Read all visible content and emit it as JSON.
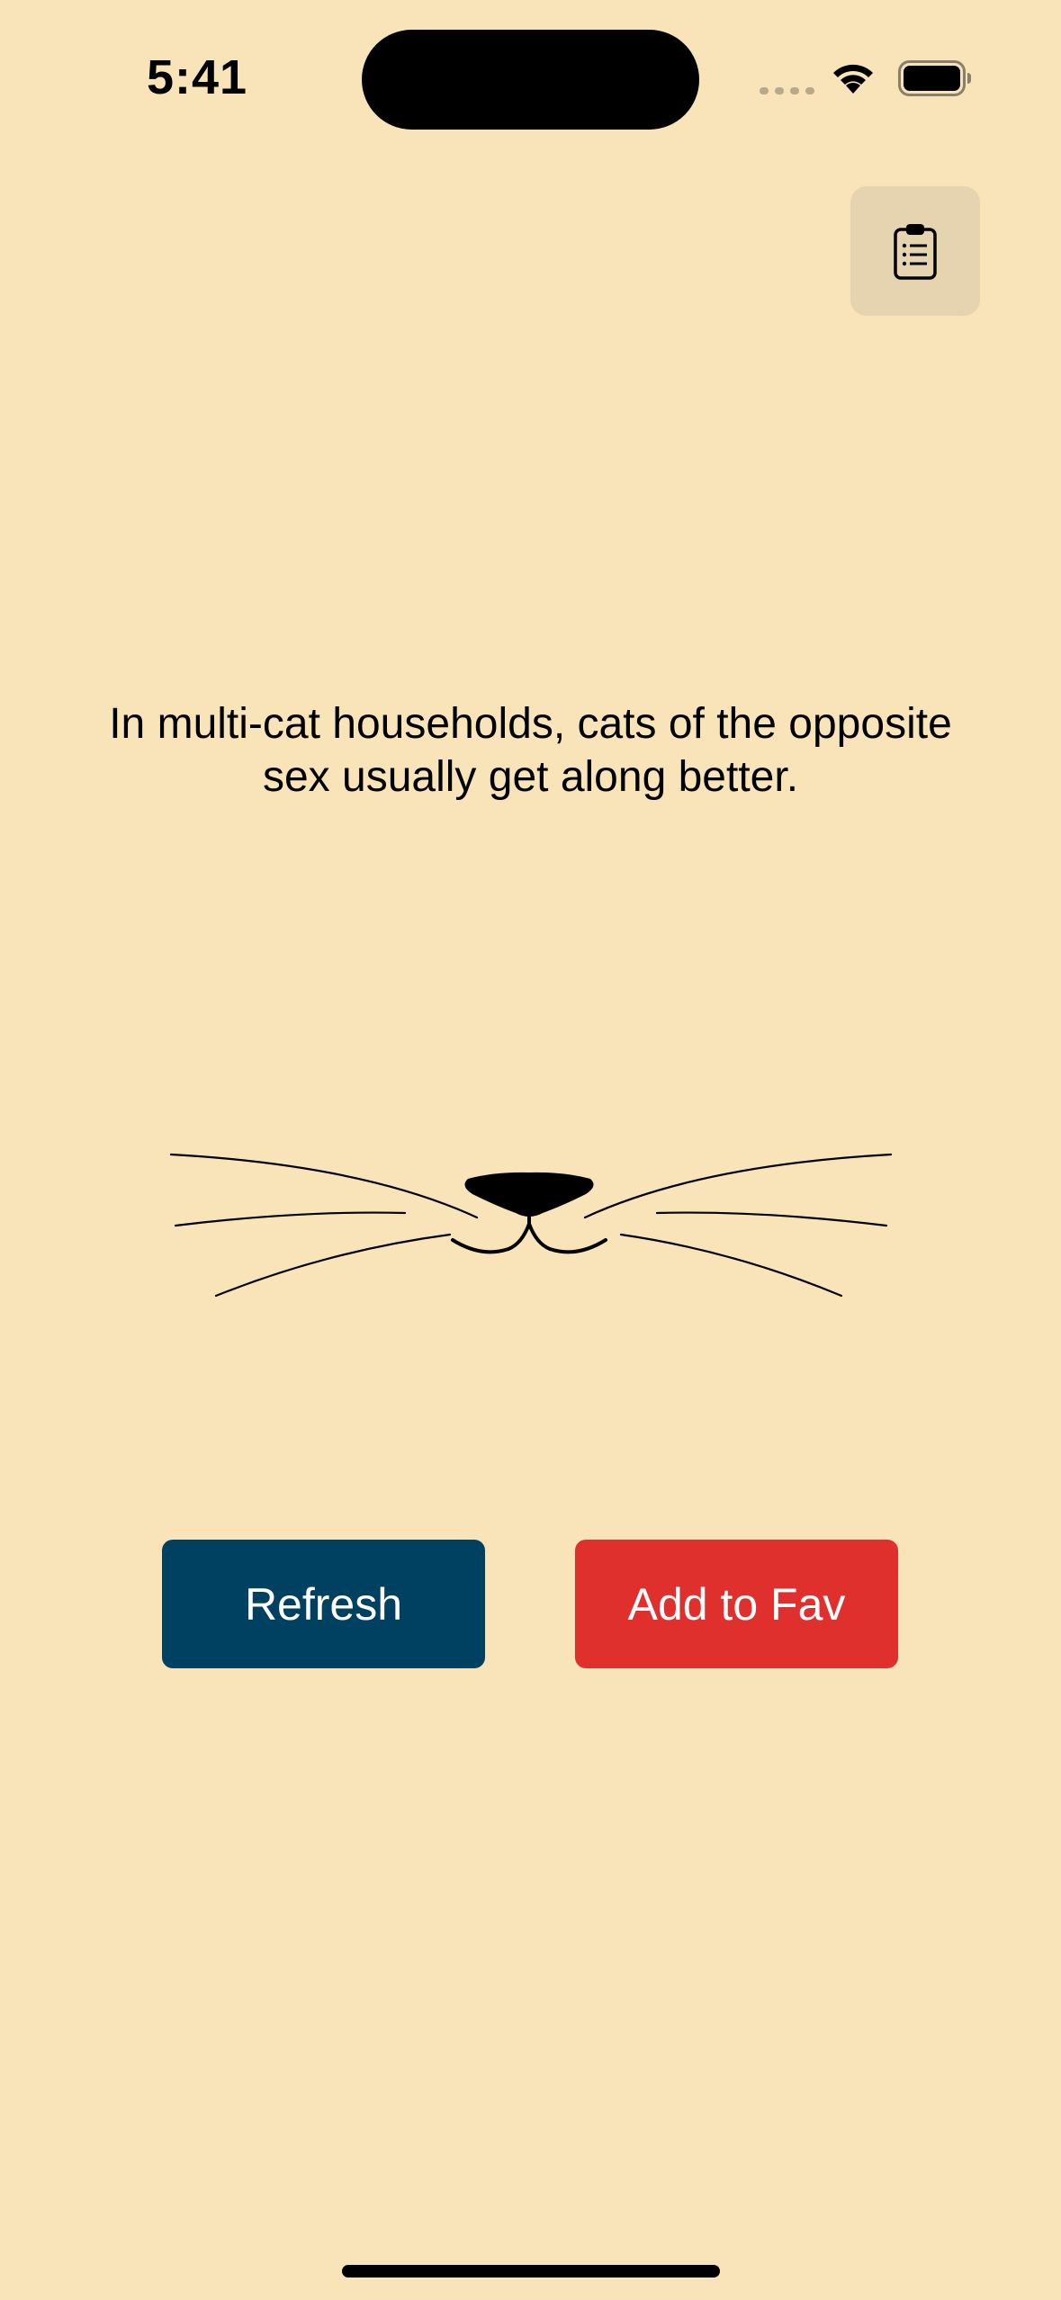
{
  "status_bar": {
    "time": "5:41"
  },
  "toolbar": {
    "clipboard_icon": "clipboard-list-icon"
  },
  "fact": {
    "text": "In multi-cat households, cats of the opposite sex usually get along better."
  },
  "illustration": {
    "icon": "cat-whiskers-icon"
  },
  "actions": {
    "refresh_label": "Refresh",
    "add_fav_label": "Add to Fav"
  },
  "colors": {
    "background": "#f8e4b8",
    "refresh_button": "#004060",
    "add_fav_button": "#e0302e",
    "clipboard_button": "#e6d4b0"
  }
}
